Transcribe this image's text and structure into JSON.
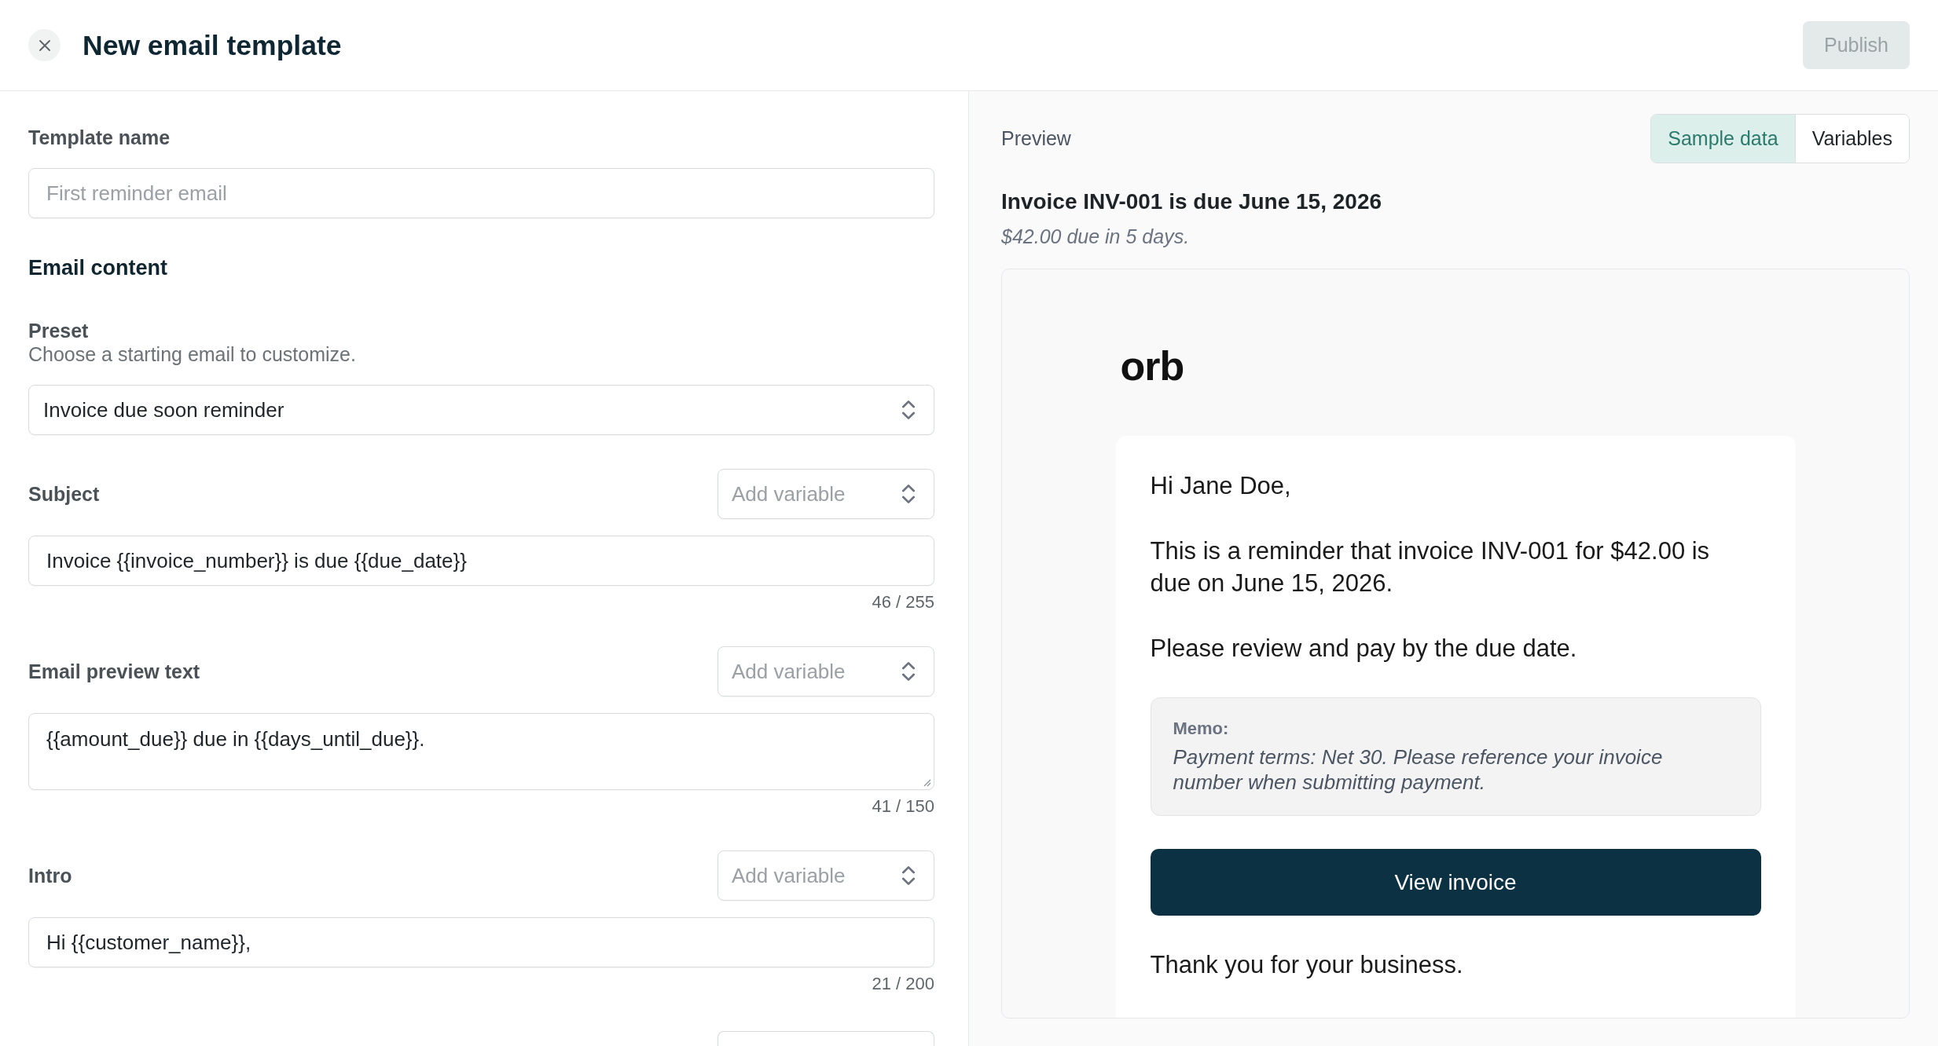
{
  "header": {
    "title": "New email template",
    "publish_button": {
      "label": "Publish",
      "disabled": true
    }
  },
  "form": {
    "template_name": {
      "label": "Template name",
      "placeholder": "First reminder email"
    },
    "section_title": "Email content",
    "preset": {
      "label": "Preset",
      "hint": "Choose a starting email to customize.",
      "value": "Invoice due soon reminder"
    },
    "fields": [
      {
        "kind": "input",
        "label": "Subject",
        "variable_select": {
          "placeholder": "Add variable"
        },
        "value": "Invoice {{invoice_number}} is due {{due_date}}",
        "count": "46 / 255"
      },
      {
        "kind": "textarea",
        "label": "Email preview text",
        "variable_select": {
          "placeholder": "Add variable"
        },
        "value": "{{amount_due}} due in {{days_until_due}}.",
        "count": "41 / 150"
      },
      {
        "kind": "input",
        "label": "Intro",
        "variable_select": {
          "placeholder": "Add variable"
        },
        "value": "Hi {{customer_name}},",
        "count": "21 / 200"
      }
    ]
  },
  "preview": {
    "label": "Preview",
    "tabs": [
      {
        "label": "Sample data",
        "selected": true
      },
      {
        "label": "Variables",
        "selected": false
      }
    ],
    "subject": "Invoice INV-001 is due June 15, 2026",
    "preview_text": "$42.00 due in 5 days.",
    "email": {
      "logo": "orb",
      "greeting": "Hi Jane Doe,",
      "paragraphs": [
        "This is a reminder that invoice INV-001 for $42.00 is due on June 15, 2026.",
        "Please review and pay by the due date."
      ],
      "memo": {
        "label": "Memo:",
        "text": "Payment terms: Net 30. Please reference your invoice number when submitting payment."
      },
      "button": "View invoice",
      "closing": "Thank you for your business."
    }
  }
}
